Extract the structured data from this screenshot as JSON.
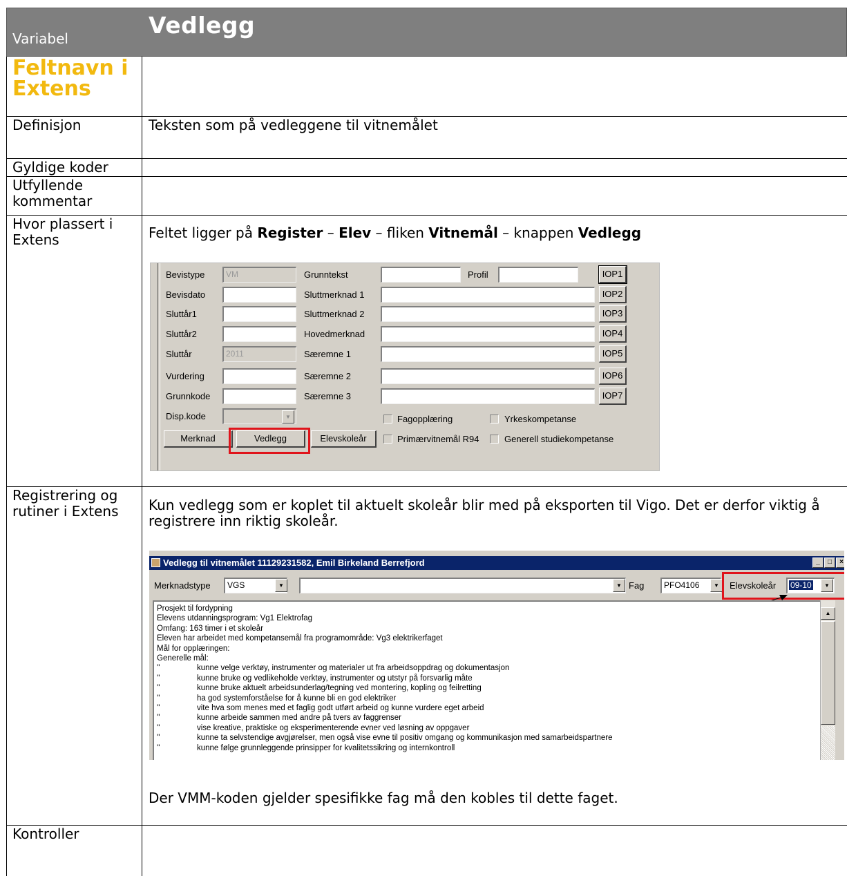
{
  "header": {
    "variable_label": "Variabel",
    "title": "Vedlegg"
  },
  "rows": {
    "feltnavn": {
      "label": "Feltnavn i Extens",
      "value": ""
    },
    "definisjon": {
      "label": "Definisjon",
      "value": "Teksten som på vedleggene til vitnemålet"
    },
    "gyldige": {
      "label": "Gyldige koder",
      "value": ""
    },
    "utfyllende": {
      "label": "Utfyllende kommentar",
      "value": ""
    },
    "hvor": {
      "label": "Hvor plassert i Extens",
      "text_1": "Feltet ligger på ",
      "bold_1": "Register",
      "text_2": " – ",
      "bold_2": "Elev",
      "text_3": " – fliken ",
      "bold_3": "Vitnemål",
      "text_4": " – knappen ",
      "bold_4": "Vedlegg"
    },
    "registrering": {
      "label": "Registrering og rutiner i Extens",
      "text": "Kun vedlegg som er koplet til aktuelt skoleår blir med på eksporten til Vigo. Det er derfor viktig å registrere inn riktig skoleår.",
      "text_after": "Der VMM-koden gjelder spesifikke fag må den kobles til dette faget."
    },
    "kontroller": {
      "label": "Kontroller",
      "value": ""
    }
  },
  "form": {
    "left_labels": [
      "Bevistype",
      "Bevisdato",
      "Sluttår1",
      "Sluttår2",
      "Sluttår",
      "Vurdering",
      "Grunnkode",
      "Disp.kode"
    ],
    "left_values": [
      "VM",
      "",
      "",
      "",
      "2011",
      "",
      "",
      ""
    ],
    "mid_labels": [
      "Grunntekst",
      "Sluttmerknad 1",
      "Sluttmerknad 2",
      "Hovedmerknad",
      "Særemne 1",
      "Særemne 2",
      "Særemne 3"
    ],
    "profil_label": "Profil",
    "iop_buttons": [
      "IOP1",
      "IOP2",
      "IOP3",
      "IOP4",
      "IOP5",
      "IOP6",
      "IOP7"
    ],
    "buttons": {
      "merknad": "Merknad",
      "vedlegg": "Vedlegg",
      "elevskolear": "Elevskoleår"
    },
    "checkboxes": [
      "Fagopplæring",
      "Yrkeskompetanse",
      "Primærvitnemål R94",
      "Generell studiekompetanse"
    ]
  },
  "window": {
    "title": "Vedlegg til vitnemålet 11129231582, Emil Birkeland Berrefjord",
    "merknadstype_label": "Merknadstype",
    "merknadstype_value": "VGS",
    "fag_label": "Fag",
    "fag_value": "PFO4106",
    "elevskolear_label": "Elevskoleår",
    "elevskolear_value": "09-10",
    "lines": [
      "Prosjekt til fordypning",
      "Elevens utdanningsprogram: Vg1 Elektrofag",
      "Omfang:  163 timer i et skoleår",
      "Eleven har arbeidet med kompetansemål fra programområde: Vg3 elektrikerfaget",
      "Mål for opplæringen:",
      "Generelle mål:"
    ],
    "goal_lines": [
      "kunne velge verktøy, instrumenter og materialer ut fra arbeidsoppdrag og dokumentasjon",
      "kunne bruke og vedlikeholde verktøy, instrumenter og utstyr på forsvarlig måte",
      "kunne bruke aktuelt arbeidsunderlag/tegning ved montering, kopling og feilretting",
      "ha god systemforståelse for å kunne bli en god elektriker",
      "vite hva som menes med et faglig godt utført arbeid og kunne vurdere eget arbeid",
      "kunne arbeide sammen med andre på tvers av faggrenser",
      "vise kreative, praktiske og eksperimenterende evner ved løsning av oppgaver",
      "kunne ta selvstendige avgjørelser, men også vise evne til positiv omgang og kommunikasjon med samarbeidspartnere",
      "kunne følge grunnleggende prinsipper for kvalitetssikring og internkontroll"
    ],
    "goal_prefix": "''"
  }
}
